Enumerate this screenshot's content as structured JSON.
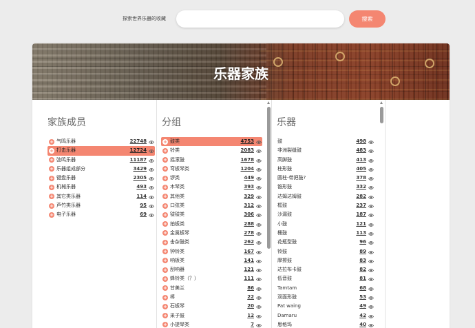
{
  "search": {
    "label": "探索世界乐器的收藏",
    "placeholder": "",
    "button": "搜索"
  },
  "hero": {
    "title": "乐器家族"
  },
  "family": {
    "title": "家族成员",
    "items": [
      {
        "name": "气鸣乐器",
        "count": "22748",
        "selected": false
      },
      {
        "name": "打击乐器",
        "count": "12724",
        "selected": true
      },
      {
        "name": "弦鸣乐器",
        "count": "11187",
        "selected": false
      },
      {
        "name": "乐器组成部分",
        "count": "3429",
        "selected": false
      },
      {
        "name": "键盘乐器",
        "count": "2305",
        "selected": false
      },
      {
        "name": "机械乐器",
        "count": "493",
        "selected": false
      },
      {
        "name": "其它类乐器",
        "count": "114",
        "selected": false
      },
      {
        "name": "芦竹类乐器",
        "count": "95",
        "selected": false
      },
      {
        "name": "电子乐器",
        "count": "69",
        "selected": false
      }
    ]
  },
  "groups": {
    "title": "分组",
    "items": [
      {
        "name": "鼓类",
        "count": "4753",
        "selected": true
      },
      {
        "name": "铃类",
        "count": "2083",
        "selected": false
      },
      {
        "name": "摇滚鼓",
        "count": "1678",
        "selected": false
      },
      {
        "name": "弯板琴类",
        "count": "1204",
        "selected": false
      },
      {
        "name": "锣类",
        "count": "449",
        "selected": false
      },
      {
        "name": "木琴类",
        "count": "393",
        "selected": false
      },
      {
        "name": "其他类",
        "count": "329",
        "selected": false
      },
      {
        "name": "口弦类",
        "count": "312",
        "selected": false
      },
      {
        "name": "钹钹类",
        "count": "306",
        "selected": false
      },
      {
        "name": "拍板类",
        "count": "288",
        "selected": false
      },
      {
        "name": "金属板琴",
        "count": "278",
        "selected": false
      },
      {
        "name": "击杂鼓类",
        "count": "262",
        "selected": false
      },
      {
        "name": "钟铃类",
        "count": "167",
        "selected": false
      },
      {
        "name": "响板类",
        "count": "141",
        "selected": false
      },
      {
        "name": "刮响器",
        "count": "121",
        "selected": false
      },
      {
        "name": "蜂铃类（？）",
        "count": "111",
        "selected": false
      },
      {
        "name": "甘美兰",
        "count": "86",
        "selected": false
      },
      {
        "name": "棒",
        "count": "22",
        "selected": false
      },
      {
        "name": "石板琴",
        "count": "20",
        "selected": false
      },
      {
        "name": "采子鼓",
        "count": "12",
        "selected": false
      },
      {
        "name": "小提琴类",
        "count": "7",
        "selected": false
      }
    ]
  },
  "instruments": {
    "title": "乐器",
    "items": [
      {
        "name": "鼓",
        "count": "498"
      },
      {
        "name": "非洲裂缝鼓",
        "count": "483"
      },
      {
        "name": "高脚鼓",
        "count": "413"
      },
      {
        "name": "柱形鼓",
        "count": "405"
      },
      {
        "name": "圆柱-带把鼓?",
        "count": "378"
      },
      {
        "name": "锥形鼓",
        "count": "332"
      },
      {
        "name": "达姆达姆鼓",
        "count": "282"
      },
      {
        "name": "框鼓",
        "count": "237"
      },
      {
        "name": "沙漏鼓",
        "count": "187"
      },
      {
        "name": "小鼓",
        "count": "121"
      },
      {
        "name": "桶鼓",
        "count": "113"
      },
      {
        "name": "花瓶型鼓",
        "count": "96"
      },
      {
        "name": "铃鼓",
        "count": "89"
      },
      {
        "name": "摩擦鼓",
        "count": "83"
      },
      {
        "name": "达拉布卡鼓",
        "count": "82"
      },
      {
        "name": "低音鼓",
        "count": "81"
      },
      {
        "name": "Tamtam",
        "count": "68"
      },
      {
        "name": "双面形鼓",
        "count": "53"
      },
      {
        "name": "Pat waing",
        "count": "49"
      },
      {
        "name": "Damaru",
        "count": "42"
      },
      {
        "name": "思格玛",
        "count": "40"
      }
    ]
  },
  "icons": {
    "add": "plus-circle-icon",
    "view": "eye-icon"
  },
  "colors": {
    "accent": "#f48671"
  }
}
